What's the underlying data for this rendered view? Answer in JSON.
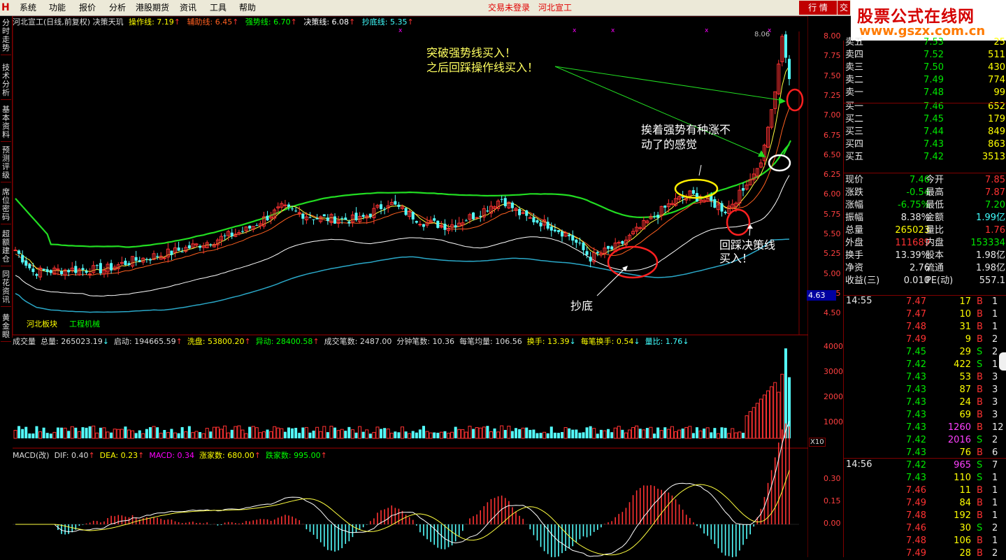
{
  "menu": {
    "items": [
      "系统",
      "功能",
      "报价",
      "分析",
      "港股期货",
      "资讯",
      "工具",
      "帮助"
    ],
    "status": "交易未登录",
    "stock": "河北宣工",
    "quote_tab": "行 情",
    "tab2": "交"
  },
  "brand": {
    "line1": "股票公式在线网",
    "line2": "www.gszx.com.cn"
  },
  "side_tabs": [
    "分时走势",
    "技术分析",
    "基本资料",
    "预测评级",
    "席位密码",
    "超额建仓",
    "同花资讯",
    "黄金眼"
  ],
  "main_legend": {
    "title": "河北宣工(日线,前复权) 决策天玑",
    "items": [
      {
        "label": "操作线: 7.19",
        "arrow": "↑",
        "color": "#ffff00"
      },
      {
        "label": "辅助线: 6.45",
        "arrow": "↑",
        "color": "#ff6020"
      },
      {
        "label": "强势线: 6.70",
        "arrow": "↑",
        "color": "#00ff00"
      },
      {
        "label": "决策线: 6.08",
        "arrow": "↑",
        "color": "#ffffff"
      },
      {
        "label": "抄底线: 5.35",
        "arrow": "↑",
        "color": "#40ffff"
      }
    ]
  },
  "price_axis": {
    "ticks": [
      "8.00",
      "7.75",
      "7.50",
      "7.25",
      "7.00",
      "6.75",
      "6.50",
      "6.25",
      "6.00",
      "5.75",
      "5.50",
      "5.25",
      "5.00",
      "4.75",
      "4.50"
    ],
    "current": "4.63",
    "high_label": "8.06"
  },
  "block_labels": {
    "sector": "河北板块",
    "industry": "工程机械"
  },
  "annotations": {
    "a1_l1": "突破强势线买入！",
    "a1_l2": "之后回踩操作线买入！",
    "a2_l1": "挨着强势有种涨不",
    "a2_l2": "动了的感觉",
    "a3_l1": "回踩决策线",
    "a3_l2": "买入！",
    "a4": "抄底"
  },
  "vol_legend": {
    "items": [
      {
        "label": "成交量",
        "color": "#dddddd"
      },
      {
        "label": "总量: 265023.19",
        "arrow": "↓",
        "color": "#dddddd"
      },
      {
        "label": "启动: 194665.59",
        "arrow": "↑",
        "color": "#dddddd"
      },
      {
        "label": "洗盘: 53800.20",
        "arrow": "↑",
        "color": "#ffff00"
      },
      {
        "label": "异动: 28400.58",
        "arrow": "↑",
        "color": "#00ff00"
      },
      {
        "label": "成交笔数: 2487.00",
        "color": "#dddddd"
      },
      {
        "label": "分钟笔数: 10.36",
        "color": "#dddddd"
      },
      {
        "label": "每笔均量: 106.56",
        "color": "#dddddd"
      },
      {
        "label": "换手: 13.39",
        "arrow": "↓",
        "color": "#ffff00"
      },
      {
        "label": "每笔换手: 0.54",
        "arrow": "↓",
        "color": "#ffff00"
      },
      {
        "label": "量比: 1.76",
        "arrow": "↓",
        "color": "#40ffff"
      }
    ],
    "ticks": [
      "40000",
      "30000",
      "20000",
      "10000"
    ],
    "unit": "X10"
  },
  "macd_legend": {
    "items": [
      {
        "label": "MACD(改)",
        "color": "#dddddd"
      },
      {
        "label": "DIF: 0.40",
        "arrow": "↑",
        "color": "#dddddd"
      },
      {
        "label": "DEA: 0.23",
        "arrow": "↑",
        "color": "#ffff00"
      },
      {
        "label": "MACD: 0.34",
        "arrow": "",
        "color": "#ff00ff"
      },
      {
        "label": "涨家数: 680.00",
        "arrow": "↑",
        "color": "#ffff00"
      },
      {
        "label": "跌家数: 995.00",
        "arrow": "↑",
        "color": "#00ff00"
      }
    ],
    "ticks": [
      "0.30",
      "0.15",
      "0.00"
    ]
  },
  "order_book": [
    {
      "label": "卖五",
      "price": "7.53",
      "vol": "25"
    },
    {
      "label": "卖四",
      "price": "7.52",
      "vol": "511"
    },
    {
      "label": "卖三",
      "price": "7.50",
      "vol": "430"
    },
    {
      "label": "卖二",
      "price": "7.49",
      "vol": "774"
    },
    {
      "label": "卖一",
      "price": "7.48",
      "vol": "99"
    },
    {
      "label": "买一",
      "price": "7.46",
      "vol": "652"
    },
    {
      "label": "买二",
      "price": "7.45",
      "vol": "179"
    },
    {
      "label": "买三",
      "price": "7.44",
      "vol": "849"
    },
    {
      "label": "买四",
      "price": "7.43",
      "vol": "863"
    },
    {
      "label": "买五",
      "price": "7.42",
      "vol": "3513"
    }
  ],
  "stats": [
    {
      "l1": "现价",
      "v1": "7.46",
      "c1": "#00e600",
      "l2": "今开",
      "v2": "7.85",
      "c2": "#ff3232"
    },
    {
      "l1": "涨跌",
      "v1": "-0.54",
      "c1": "#00e600",
      "l2": "最高",
      "v2": "7.87",
      "c2": "#ff3232"
    },
    {
      "l1": "涨幅",
      "v1": "-6.75%",
      "c1": "#00e600",
      "l2": "最低",
      "v2": "7.20",
      "c2": "#00e600"
    },
    {
      "l1": "振幅",
      "v1": "8.38%",
      "c1": "#e8e8e8",
      "l2": "金额",
      "v2": "1.99亿",
      "c2": "#40ffff"
    },
    {
      "l1": "总量",
      "v1": "265023",
      "c1": "#ffff00",
      "l2": "量比",
      "v2": "1.76",
      "c2": "#ff3232"
    },
    {
      "l1": "外盘",
      "v1": "111689",
      "c1": "#ff3232",
      "l2": "内盘",
      "v2": "153334",
      "c2": "#00e600"
    },
    {
      "l1": "换手",
      "v1": "13.39%",
      "c1": "#e8e8e8",
      "l2": "股本",
      "v2": "1.98亿",
      "c2": "#e8e8e8"
    },
    {
      "l1": "净资",
      "v1": "2.76",
      "c1": "#e8e8e8",
      "l2": "流通",
      "v2": "1.98亿",
      "c2": "#e8e8e8"
    },
    {
      "l1": "收益(三)",
      "v1": "0.010",
      "c1": "#e8e8e8",
      "l2": "PE(动)",
      "v2": "557.1",
      "c2": "#e8e8e8"
    }
  ],
  "ticks1": {
    "time": "14:55",
    "rows": [
      {
        "p": "7.47",
        "v": "17",
        "s": "B",
        "n": "1"
      },
      {
        "p": "7.47",
        "v": "10",
        "s": "B",
        "n": "1"
      },
      {
        "p": "7.48",
        "v": "31",
        "s": "B",
        "n": "1"
      },
      {
        "p": "7.49",
        "v": "9",
        "s": "B",
        "n": "2"
      },
      {
        "p": "7.45",
        "v": "29",
        "s": "S",
        "n": "2"
      },
      {
        "p": "7.42",
        "v": "422",
        "s": "S",
        "n": "1"
      },
      {
        "p": "7.43",
        "v": "53",
        "s": "B",
        "n": "3"
      },
      {
        "p": "7.43",
        "v": "87",
        "s": "B",
        "n": "3"
      },
      {
        "p": "7.43",
        "v": "24",
        "s": "B",
        "n": "3"
      },
      {
        "p": "7.43",
        "v": "69",
        "s": "B",
        "n": "3"
      },
      {
        "p": "7.43",
        "v": "1260",
        "s": "B",
        "n": "12"
      },
      {
        "p": "7.42",
        "v": "2016",
        "s": "S",
        "n": "2"
      },
      {
        "p": "7.43",
        "v": "76",
        "s": "B",
        "n": "6"
      }
    ]
  },
  "ticks2": {
    "time": "14:56",
    "rows": [
      {
        "p": "7.42",
        "v": "965",
        "s": "S",
        "n": "7"
      },
      {
        "p": "7.43",
        "v": "110",
        "s": "S",
        "n": "1"
      },
      {
        "p": "7.46",
        "v": "11",
        "s": "B",
        "n": "1"
      },
      {
        "p": "7.49",
        "v": "84",
        "s": "B",
        "n": "1"
      },
      {
        "p": "7.48",
        "v": "192",
        "s": "B",
        "n": "1"
      },
      {
        "p": "7.46",
        "v": "30",
        "s": "S",
        "n": "2"
      },
      {
        "p": "7.48",
        "v": "106",
        "s": "B",
        "n": "1"
      },
      {
        "p": "7.49",
        "v": "28",
        "s": "B",
        "n": "2"
      }
    ]
  }
}
